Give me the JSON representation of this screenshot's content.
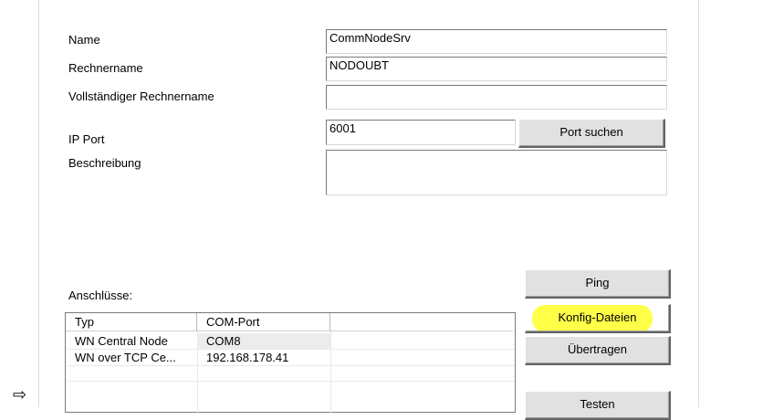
{
  "form": {
    "name_label": "Name",
    "name_value": "CommNodeSrv",
    "computer_label": "Rechnername",
    "computer_value": "NODOUBT",
    "fullname_label": "Vollständiger Rechnername",
    "fullname_value": "",
    "port_label": "IP Port",
    "port_value": "6001",
    "desc_label": "Beschreibung",
    "desc_value": ""
  },
  "buttons": {
    "port_search": "Port suchen",
    "ping": "Ping",
    "config_files": "Konfig-Dateien",
    "transfer": "Übertragen",
    "test": "Testen"
  },
  "connections": {
    "label": "Anschlüsse:",
    "columns": [
      "Typ",
      "COM-Port",
      ""
    ],
    "rows": [
      {
        "type": "WN Central Node",
        "port": "COM8"
      },
      {
        "type": "WN over TCP Ce...",
        "port": "192.168.178.41"
      }
    ]
  },
  "annotation": {
    "arrow_icon": "arrow-right-outline-icon",
    "highlight_color": "#ffff33"
  }
}
